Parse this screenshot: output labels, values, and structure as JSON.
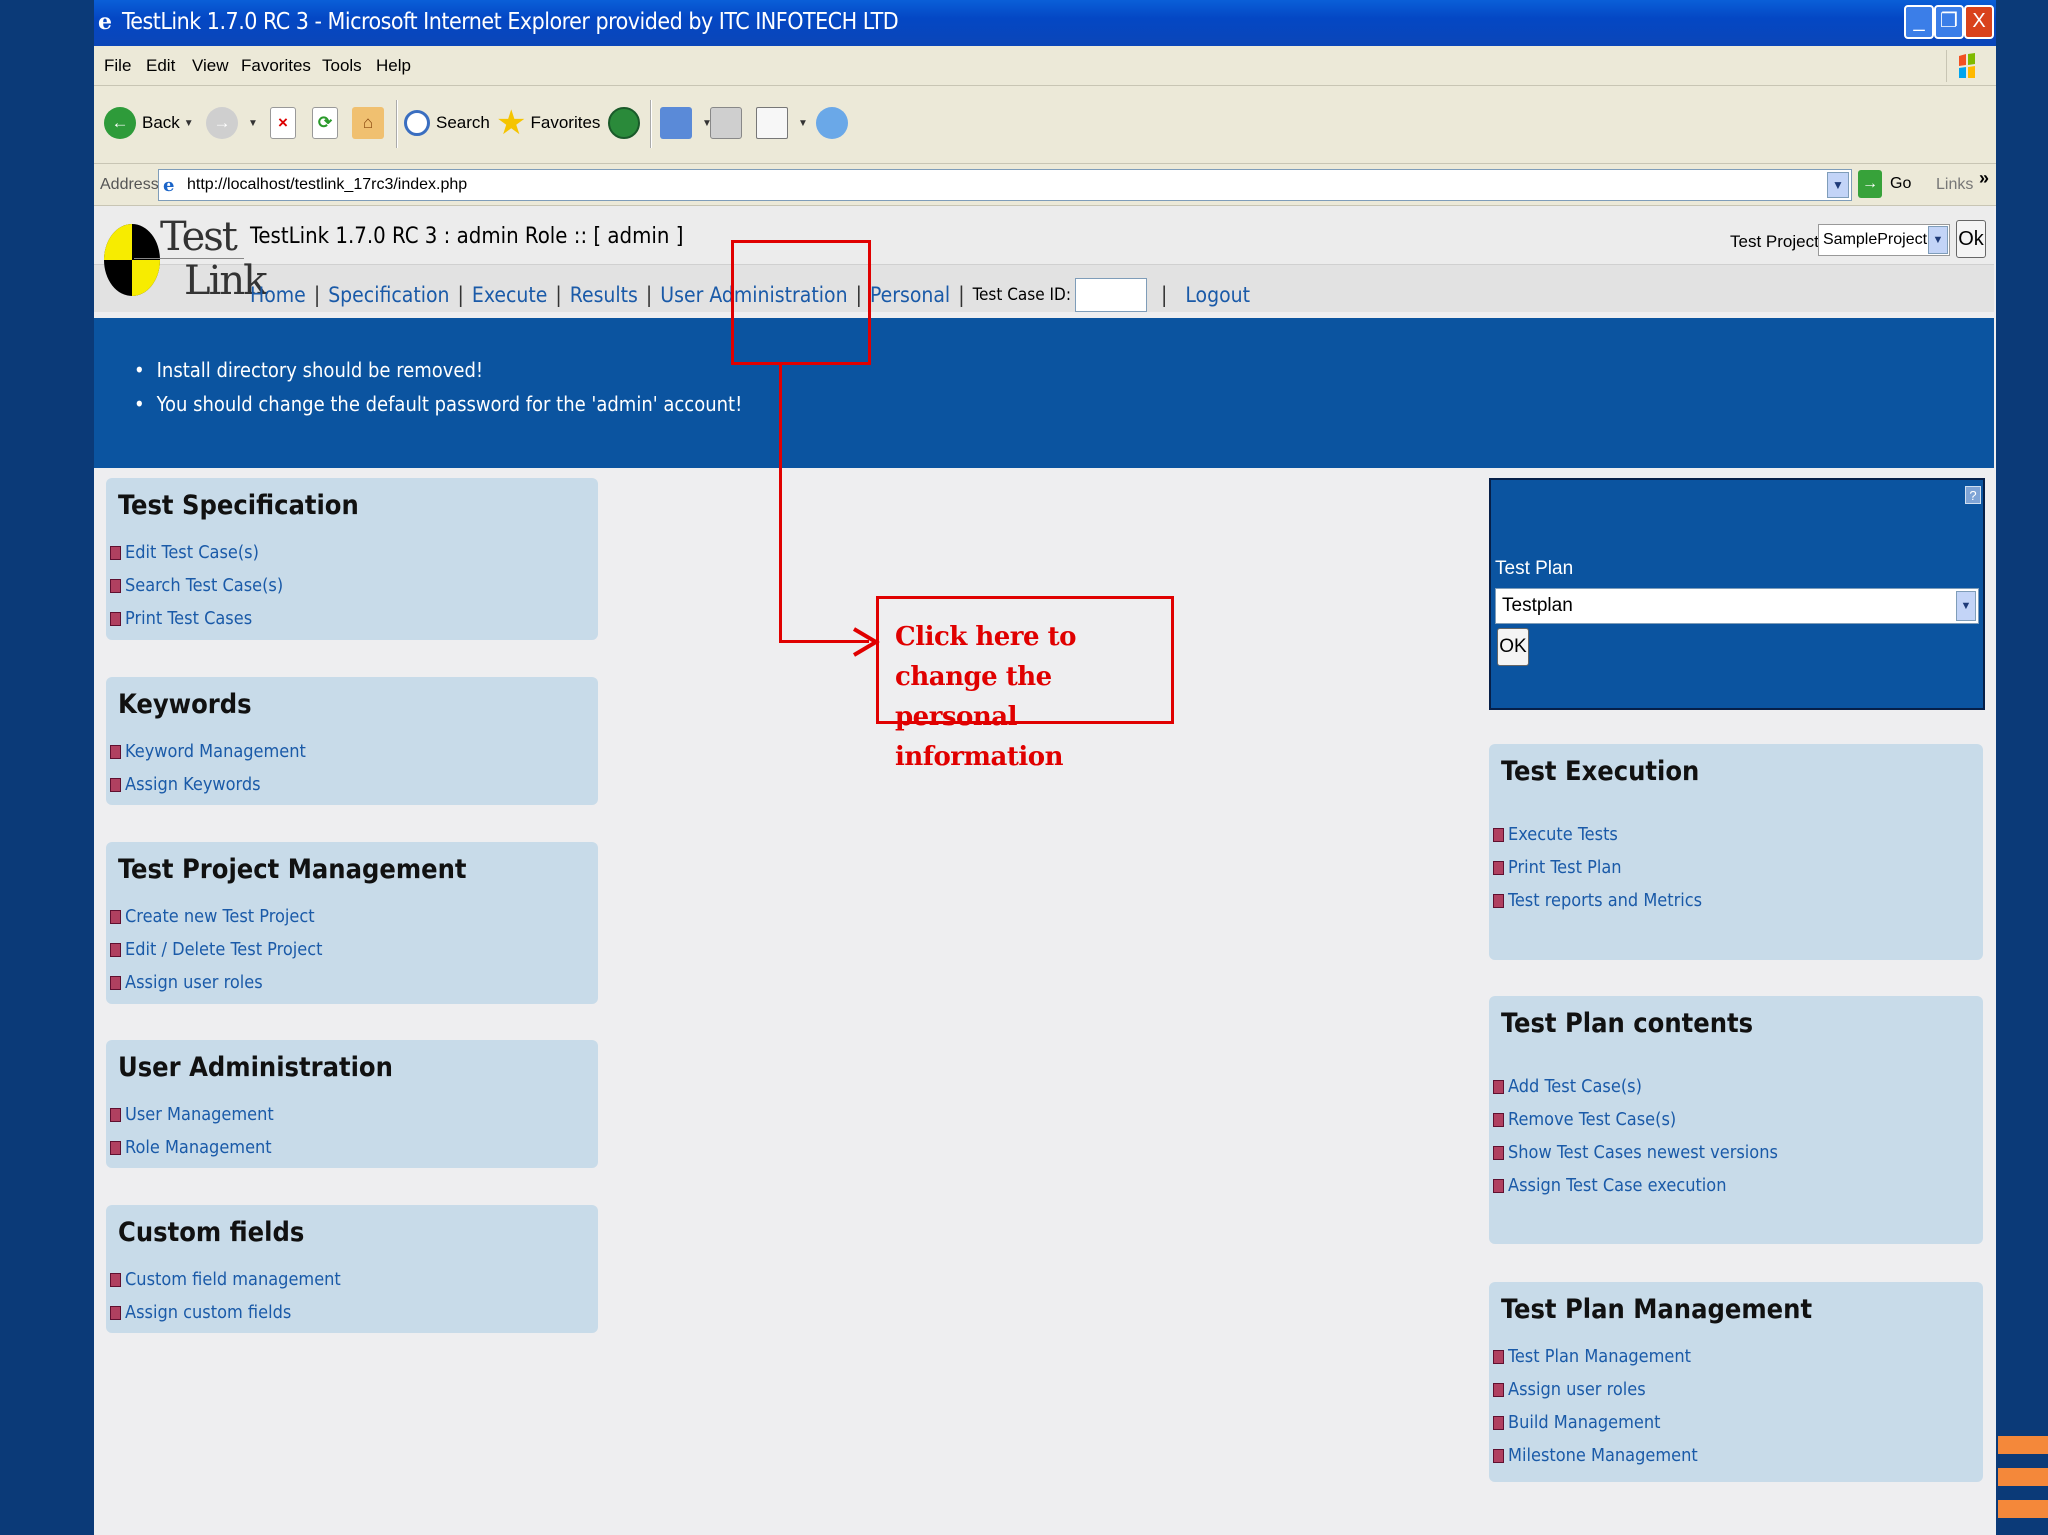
{
  "window": {
    "title": "TestLink 1.7.0 RC 3 - Microsoft Internet Explorer provided by ITC INFOTECH LTD",
    "minimize": "_",
    "restore": "❐",
    "close": "X"
  },
  "menubar": {
    "items": [
      "File",
      "Edit",
      "View",
      "Favorites",
      "Tools",
      "Help"
    ]
  },
  "toolbar": {
    "back_label": "Back",
    "search_label": "Search",
    "favorites_label": "Favorites"
  },
  "addressbar": {
    "label": "Address",
    "url": "http://localhost/testlink_17rc3/index.php",
    "go_label": "Go",
    "links_label": "Links",
    "chevron": "»"
  },
  "header": {
    "logo_line1": "Test",
    "logo_line2": "Link",
    "title": "TestLink 1.7.0 RC 3 : admin Role :: [ admin ]",
    "test_project_label": "Test Project",
    "test_project_value": "SampleProject",
    "ok_label": "Ok"
  },
  "nav": {
    "home": "Home",
    "specification": "Specification",
    "execute": "Execute",
    "results": "Results",
    "user_admin": "User Administration",
    "personal": "Personal",
    "tcid_label": "Test Case ID:",
    "logout": "Logout",
    "separator": "|"
  },
  "alerts": [
    "Install directory should be removed!",
    "You should change the default password for the 'admin' account!"
  ],
  "left_panels": [
    {
      "title": "Test Specification",
      "links": [
        "Edit Test Case(s)",
        "Search Test Case(s)",
        "Print Test Cases"
      ]
    },
    {
      "title": "Keywords",
      "links": [
        "Keyword Management",
        "Assign Keywords"
      ]
    },
    {
      "title": "Test Project Management",
      "links": [
        "Create new Test Project",
        "Edit / Delete Test Project",
        "Assign user roles"
      ]
    },
    {
      "title": "User Administration",
      "links": [
        "User Management",
        "Role Management"
      ]
    },
    {
      "title": "Custom fields",
      "links": [
        "Custom field management",
        "Assign custom fields"
      ]
    }
  ],
  "test_plan_box": {
    "help": "?",
    "label": "Test Plan",
    "selected": "Testplan",
    "ok_label": "OK"
  },
  "right_panels": [
    {
      "title": "Test Execution",
      "links": [
        "Execute Tests",
        "Print Test Plan",
        "Test reports and Metrics"
      ]
    },
    {
      "title": "Test Plan contents",
      "links": [
        "Add Test Case(s)",
        "Remove Test Case(s)",
        "Show Test Cases newest versions",
        "Assign Test Case execution"
      ]
    },
    {
      "title": "Test Plan Management",
      "links": [
        "Test Plan Management",
        "Assign user roles",
        "Build Management",
        "Milestone Management"
      ]
    }
  ],
  "annotation": {
    "line1": "Click here to change the",
    "line2": "personal information",
    "color": "#e00000"
  }
}
